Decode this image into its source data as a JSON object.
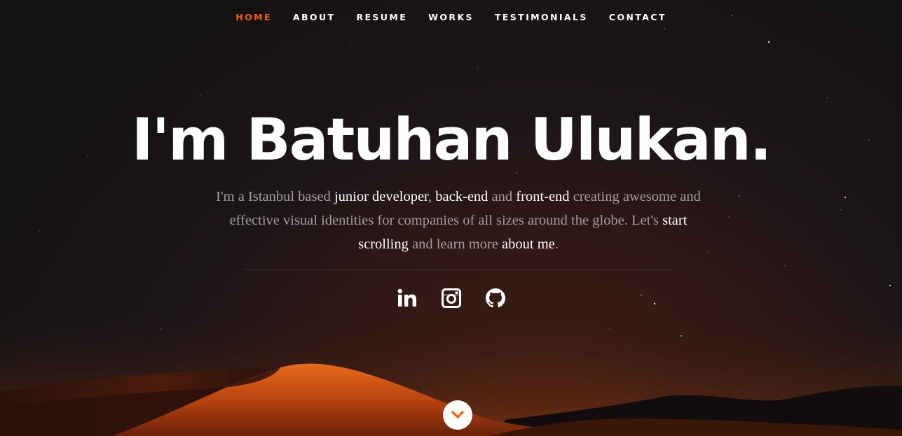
{
  "nav": {
    "items": [
      {
        "label": "HOME",
        "active": true
      },
      {
        "label": "ABOUT",
        "active": false
      },
      {
        "label": "RESUME",
        "active": false
      },
      {
        "label": "WORKS",
        "active": false
      },
      {
        "label": "TESTIMONIALS",
        "active": false
      },
      {
        "label": "CONTACT",
        "active": false
      }
    ],
    "active_color": "#f06000"
  },
  "hero": {
    "headline": "I'm Batuhan Ulukan.",
    "intro": {
      "t1": "I'm a Istanbul based ",
      "h1": "junior developer",
      "t2": ", ",
      "h2": "back-end",
      "t3": " and ",
      "h3": "front-end",
      "t4": " creating awesome and effective visual identities for companies of all sizes around the globe. Let's ",
      "h4": "start scrolling",
      "t5": " and learn more ",
      "h5": "about me",
      "t6": "."
    }
  },
  "social": [
    {
      "icon": "linkedin-icon"
    },
    {
      "icon": "instagram-icon"
    },
    {
      "icon": "github-icon"
    }
  ],
  "scroll_down": {
    "icon": "chevron-down-icon",
    "color": "#f06000"
  }
}
